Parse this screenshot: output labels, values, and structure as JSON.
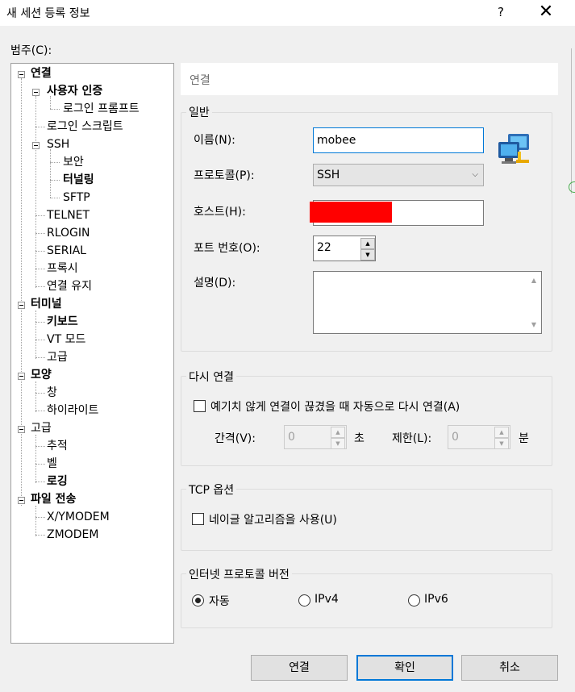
{
  "window": {
    "title": "새 세션 등록 정보",
    "help": "?",
    "close": "✕"
  },
  "category_label": "범주(C):",
  "tree": {
    "connection": "연결",
    "user_auth": "사용자 인증",
    "login_prompt": "로그인 프롬프트",
    "login_script": "로그인 스크립트",
    "ssh": "SSH",
    "security": "보안",
    "tunneling": "터널링",
    "sftp": "SFTP",
    "telnet": "TELNET",
    "rlogin": "RLOGIN",
    "serial": "SERIAL",
    "proxy": "프록시",
    "keepalive": "연결 유지",
    "terminal": "터미널",
    "keyboard": "키보드",
    "vt_mode": "VT 모드",
    "advanced_term": "고급",
    "appearance": "모양",
    "window": "창",
    "highlight": "하이라이트",
    "advanced": "고급",
    "trace": "추적",
    "bell": "벨",
    "logging": "로깅",
    "file_transfer": "파일 전송",
    "xymodem": "X/YMODEM",
    "zmodem": "ZMODEM"
  },
  "panel_header": "연결",
  "general": {
    "title": "일반",
    "name_label": "이름(N):",
    "name_value": "mobee",
    "protocol_label": "프로토콜(P):",
    "protocol_value": "SSH",
    "host_label": "호스트(H):",
    "port_label": "포트 번호(O):",
    "port_value": "22",
    "desc_label": "설명(D):"
  },
  "reconnect": {
    "title": "다시 연결",
    "checkbox_label": "예기치 않게 연결이 끊겼을 때 자동으로 다시 연결(A)",
    "interval_label": "간격(V):",
    "interval_value": "0",
    "interval_unit": "초",
    "limit_label": "제한(L):",
    "limit_value": "0",
    "limit_unit": "분"
  },
  "tcp": {
    "title": "TCP 옵션",
    "nagle_label": "네이글 알고리즘을 사용(U)"
  },
  "ip_version": {
    "title": "인터넷 프로토콜 버전",
    "options": [
      "자동",
      "IPv4",
      "IPv6"
    ],
    "selected": "자동"
  },
  "buttons": {
    "connect": "연결",
    "ok": "확인",
    "cancel": "취소"
  },
  "colors": {
    "accent": "#0078d7",
    "redaction": "#ff0000"
  }
}
